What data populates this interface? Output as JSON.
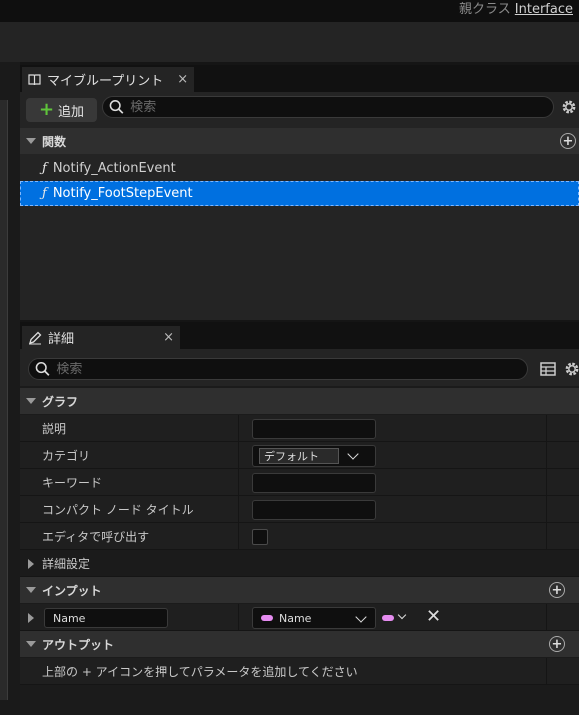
{
  "header": {
    "parent_class_label": "親クラス",
    "parent_class_value": "Interface"
  },
  "my_blueprint": {
    "tab_label": "マイブループリント",
    "tab_close": "×",
    "add_button_label": "追加",
    "add_button_icon": "plus-icon",
    "search_placeholder": "検索",
    "sections": {
      "functions": {
        "label": "関数",
        "items": [
          {
            "icon": "function-icon",
            "glyph": "ƒ",
            "label": "Notify_ActionEvent",
            "selected": false
          },
          {
            "icon": "function-icon",
            "glyph": "ƒ",
            "label": "Notify_FootStepEvent",
            "selected": true
          }
        ]
      }
    }
  },
  "details": {
    "tab_label": "詳細",
    "tab_close": "×",
    "search_placeholder": "検索",
    "graph_section": {
      "label": "グラフ",
      "rows": {
        "description": {
          "label": "説明",
          "value": ""
        },
        "category": {
          "label": "カテゴリ",
          "value": "デフォルト"
        },
        "keywords": {
          "label": "キーワード",
          "value": ""
        },
        "compact_title": {
          "label": "コンパクト ノード タイトル",
          "value": ""
        },
        "call_in_editor": {
          "label": "エディタで呼び出す",
          "checked": false
        }
      }
    },
    "advanced_label": "詳細設定",
    "inputs_section": {
      "label": "インプット",
      "param": {
        "name": "Name",
        "type": "Name",
        "type_color": "#e58cf0"
      }
    },
    "outputs_section": {
      "label": "アウトプット",
      "hint": "上部の + アイコンを押してパラメータを追加してください"
    }
  },
  "colors": {
    "selection": "#0070e0",
    "add_plus": "#5fc43b",
    "name_pin": "#e58cf0"
  }
}
